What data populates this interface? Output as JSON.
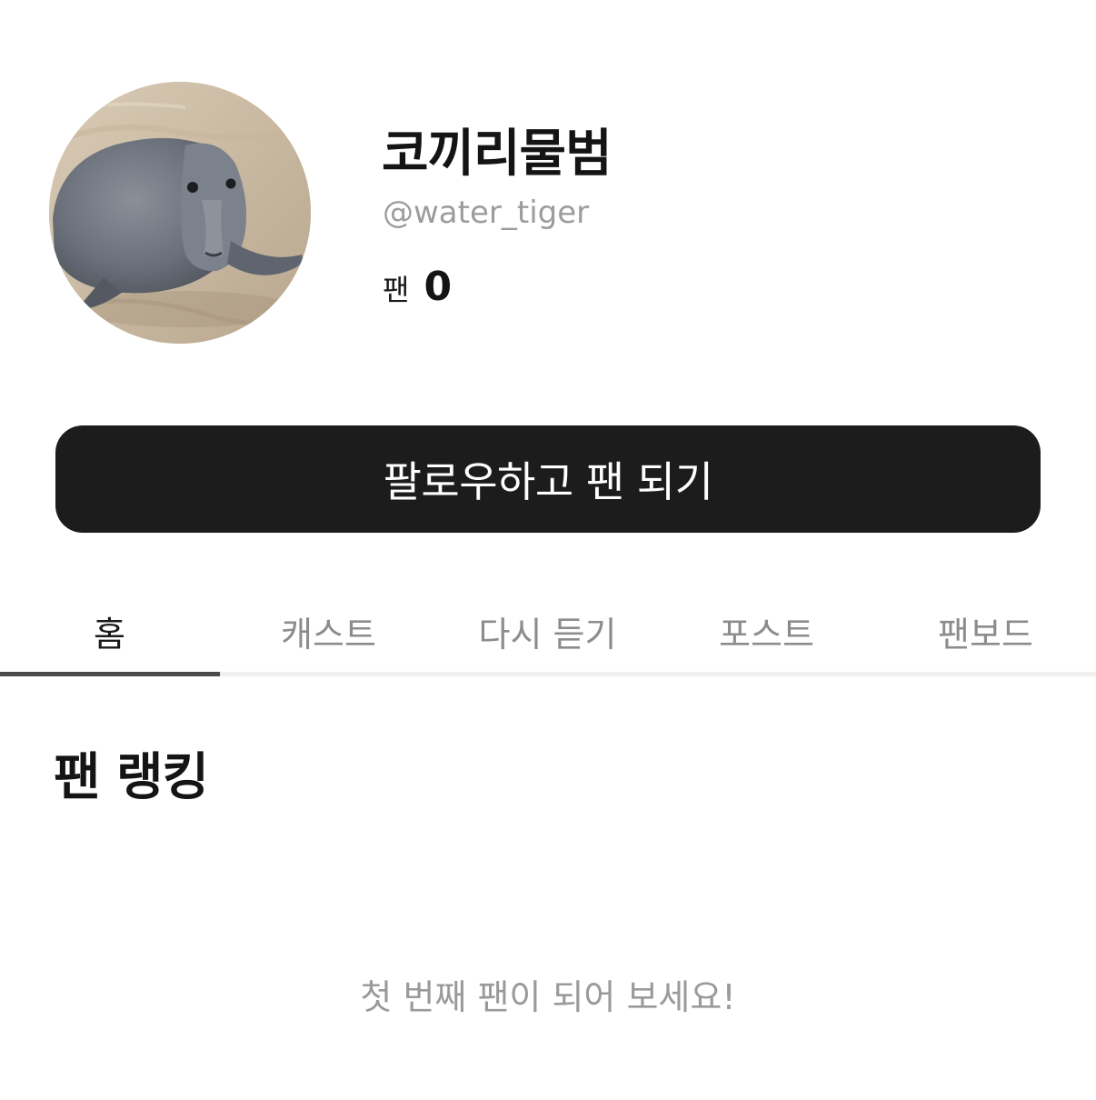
{
  "profile": {
    "avatar_icon": "elephant-seal-photo",
    "name": "코끼리물범",
    "handle": "@water_tiger",
    "fan_label": "팬",
    "fan_count": "0"
  },
  "actions": {
    "follow_label": "팔로우하고 팬 되기"
  },
  "tabs": [
    {
      "label": "홈",
      "active": true
    },
    {
      "label": "캐스트",
      "active": false
    },
    {
      "label": "다시 듣기",
      "active": false
    },
    {
      "label": "포스트",
      "active": false
    },
    {
      "label": "팬보드",
      "active": false
    }
  ],
  "fan_ranking": {
    "title": "팬 랭킹",
    "empty_message": "첫 번째 팬이 되어 보세요!"
  },
  "colors": {
    "button_background": "#1c1c1c",
    "active_tab_indicator": "#4a4a4a",
    "muted_text": "#9c9c9c"
  }
}
